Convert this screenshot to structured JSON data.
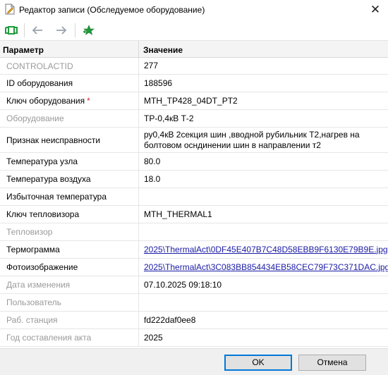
{
  "window": {
    "title": "Редактор записи (Обследуемое оборудование)",
    "close_glyph": "✕",
    "icon": "document-edit-icon"
  },
  "toolbar": {
    "buttons": [
      {
        "name": "save-record-button",
        "icon": "save-green-icon",
        "enabled": true
      },
      {
        "name": "back-button",
        "icon": "arrow-left-icon",
        "enabled": false
      },
      {
        "name": "forward-button",
        "icon": "arrow-right-icon",
        "enabled": false
      },
      {
        "name": "favorite-button",
        "icon": "star-plus-icon",
        "enabled": true
      }
    ]
  },
  "grid": {
    "header": {
      "param": "Параметр",
      "value": "Значение"
    },
    "rows": [
      {
        "param": "CONTROLACTID",
        "value": "277",
        "readonly": true
      },
      {
        "param": "ID оборудования",
        "value": "188596",
        "readonly": false
      },
      {
        "param": "Ключ оборудования",
        "value": "MTH_TP428_04DT_PT2",
        "readonly": false,
        "required": true
      },
      {
        "param": "Оборудование",
        "value": "ТР-0,4кВ Т-2",
        "readonly": true
      },
      {
        "param": "Признак неисправности",
        "value": "ру0,4кВ 2секция шин ,вводной рубильник Т2,нагрев на болтовом осндинении шин в направлении т2",
        "readonly": false
      },
      {
        "param": "Температура узла",
        "value": "80.0",
        "readonly": false
      },
      {
        "param": "Температура воздуха",
        "value": "18.0",
        "readonly": false
      },
      {
        "param": "Избыточная температура",
        "value": "",
        "readonly": false
      },
      {
        "param": "Ключ тепловизора",
        "value": "MTH_THERMAL1",
        "readonly": false
      },
      {
        "param": "Тепловизор",
        "value": "",
        "readonly": true
      },
      {
        "param": "Термограмма",
        "value": "2025\\ThermalAct\\0DF45E407B7C48D58EBB9F6130E79B9E.jpg",
        "readonly": false,
        "link": true
      },
      {
        "param": "Фотоизображение",
        "value": "2025\\ThermalAct\\3C083BB854434EB58CEC79F73C371DAC.jpg",
        "readonly": false,
        "link": true
      },
      {
        "param": "Дата изменения",
        "value": "07.10.2025 09:18:10",
        "readonly": true
      },
      {
        "param": "Пользователь",
        "value": "",
        "readonly": true
      },
      {
        "param": "Раб. станция",
        "value": "fd222daf0ee8",
        "readonly": true
      },
      {
        "param": "Год составления акта",
        "value": "2025",
        "readonly": true
      }
    ]
  },
  "footer": {
    "ok_label": "OK",
    "cancel_label": "Отмена"
  },
  "colors": {
    "link": "#1a1aa6",
    "readonly_text": "#9a9a9a",
    "required_mark": "#d12a2a",
    "accent_border": "#0078d7"
  }
}
